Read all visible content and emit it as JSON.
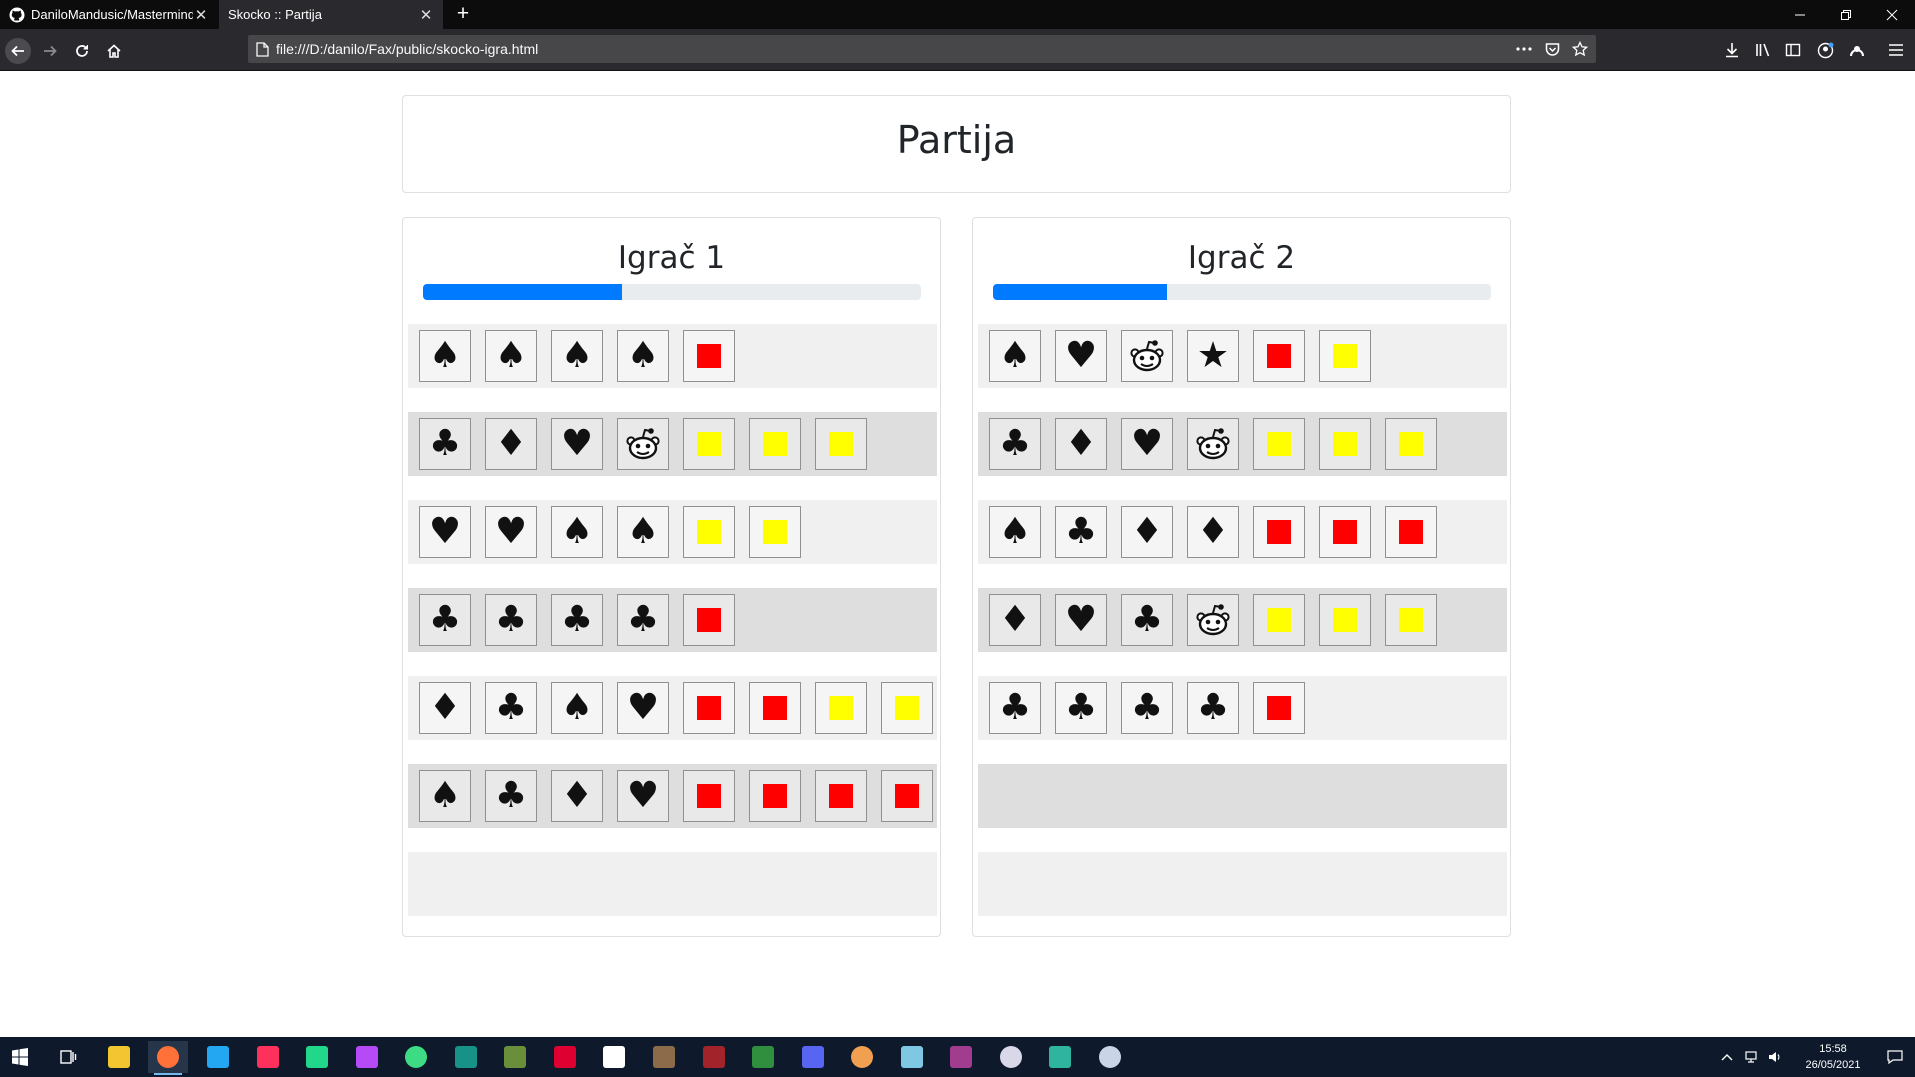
{
  "browser": {
    "tabs": [
      {
        "title": "DaniloMandusic/Mastermind-",
        "icon": "github-icon",
        "active": false
      },
      {
        "title": "Skocko :: Partija",
        "icon": "page-icon",
        "active": true
      }
    ],
    "url": "file:///D:/danilo/Fax/public/skocko-igra.html"
  },
  "page": {
    "title": "Partija"
  },
  "players": [
    {
      "name": "Igrač 1",
      "progress": 0.4,
      "rows": [
        {
          "symbols": [
            "spade",
            "spade",
            "spade",
            "spade"
          ],
          "pegs": [
            "red"
          ]
        },
        {
          "symbols": [
            "club",
            "diamond",
            "heart",
            "skocko"
          ],
          "pegs": [
            "yellow",
            "yellow",
            "yellow"
          ]
        },
        {
          "symbols": [
            "heart",
            "heart",
            "spade",
            "spade"
          ],
          "pegs": [
            "yellow",
            "yellow"
          ]
        },
        {
          "symbols": [
            "club",
            "club",
            "club",
            "club"
          ],
          "pegs": [
            "red"
          ]
        },
        {
          "symbols": [
            "diamond",
            "club",
            "spade",
            "heart"
          ],
          "pegs": [
            "red",
            "red",
            "yellow",
            "yellow"
          ]
        },
        {
          "symbols": [
            "spade",
            "club",
            "diamond",
            "heart"
          ],
          "pegs": [
            "red",
            "red",
            "red",
            "red"
          ]
        },
        {
          "symbols": [],
          "pegs": []
        }
      ]
    },
    {
      "name": "Igrač 2",
      "progress": 0.35,
      "rows": [
        {
          "symbols": [
            "spade",
            "heart",
            "skocko",
            "star"
          ],
          "pegs": [
            "red",
            "yellow"
          ]
        },
        {
          "symbols": [
            "club",
            "diamond",
            "heart",
            "skocko"
          ],
          "pegs": [
            "yellow",
            "yellow",
            "yellow"
          ]
        },
        {
          "symbols": [
            "spade",
            "club",
            "diamond",
            "diamond"
          ],
          "pegs": [
            "red",
            "red",
            "red"
          ]
        },
        {
          "symbols": [
            "diamond",
            "heart",
            "club",
            "skocko"
          ],
          "pegs": [
            "yellow",
            "yellow",
            "yellow"
          ]
        },
        {
          "symbols": [
            "club",
            "club",
            "club",
            "club"
          ],
          "pegs": [
            "red"
          ]
        },
        {
          "symbols": [],
          "pegs": []
        },
        {
          "symbols": [],
          "pegs": []
        }
      ]
    }
  ],
  "colors": {
    "red": "#ff0000",
    "yellow": "#ffff00",
    "progress": "#007bff"
  },
  "taskbar": {
    "time": "15:58",
    "date": "26/05/2021"
  }
}
